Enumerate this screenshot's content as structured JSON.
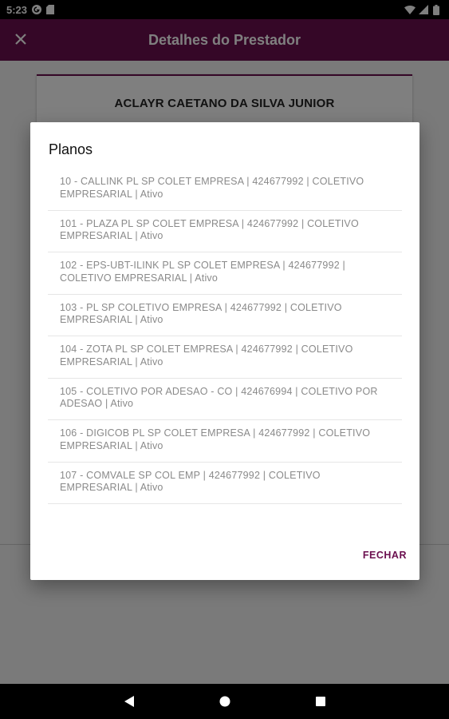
{
  "status_bar": {
    "time": "5:23",
    "icons": [
      "google-icon",
      "sd-card-icon",
      "wifi-icon",
      "signal-icon",
      "battery-icon"
    ]
  },
  "app_bar": {
    "title": "Detalhes do Prestador",
    "close_icon": "close-icon",
    "color": "#6b0f4f"
  },
  "provider": {
    "name": "ACLAYR CAETANO DA SILVA JUNIOR"
  },
  "dialog": {
    "title": "Planos",
    "items": [
      "10 - CALLINK PL SP COLET EMPRESA | 424677992 | COLETIVO EMPRESARIAL | Ativo",
      "101 - PLAZA PL SP COLET EMPRESA | 424677992 | COLETIVO EMPRESARIAL | Ativo",
      "102 - EPS-UBT-ILINK PL SP COLET EMPRESA | 424677992 | COLETIVO EMPRESARIAL | Ativo",
      "103 - PL SP COLETIVO EMPRESA | 424677992 | COLETIVO EMPRESARIAL | Ativo",
      "104 - ZOTA PL SP COLET EMPRESA | 424677992 | COLETIVO EMPRESARIAL | Ativo",
      "105 - COLETIVO POR ADESAO - CO | 424676994 | COLETIVO POR ADESAO | Ativo",
      "106 - DIGICOB PL SP COLET EMPRESA | 424677992 | COLETIVO EMPRESARIAL | Ativo",
      "107 - COMVALE SP COL EMP | 424677992 | COLETIVO EMPRESARIAL | Ativo"
    ],
    "close_label": "FECHAR"
  },
  "nav_bar": {
    "icons": [
      "back-icon",
      "home-icon",
      "recents-icon"
    ]
  }
}
